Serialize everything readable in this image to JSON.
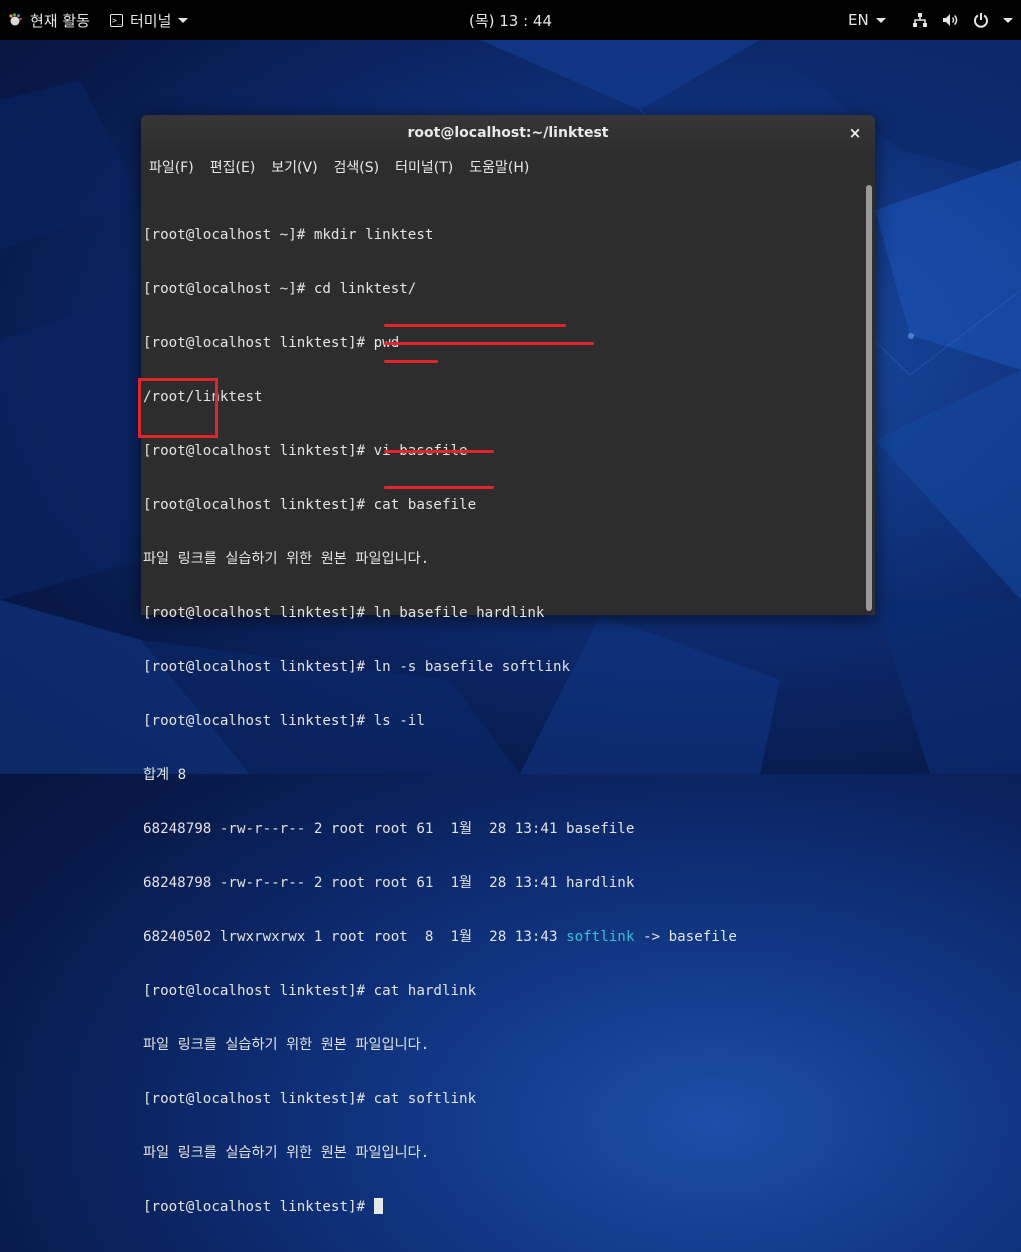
{
  "topbar": {
    "activities": "현재 활동",
    "app_menu": "터미널",
    "clock": "(목) 13 : 44",
    "language": "EN",
    "icons": [
      "network-icon",
      "volume-icon",
      "power-icon"
    ]
  },
  "window": {
    "title": "root@localhost:~/linktest",
    "close": "×",
    "menu": [
      "파일(F)",
      "편집(E)",
      "보기(V)",
      "검색(S)",
      "터미널(T)",
      "도움말(H)"
    ]
  },
  "terminal": {
    "lines": [
      "[root@localhost ~]# mkdir linktest",
      "[root@localhost ~]# cd linktest/",
      "[root@localhost linktest]# pwd",
      "/root/linktest",
      "[root@localhost linktest]# vi basefile",
      "[root@localhost linktest]# cat basefile",
      "파일 링크를 실습하기 위한 원본 파일입니다.",
      "[root@localhost linktest]# ln basefile hardlink",
      "[root@localhost linktest]# ln -s basefile softlink",
      "[root@localhost linktest]# ls -il",
      "합계 8",
      "68248798 -rw-r--r-- 2 root root 61  1월  28 13:41 basefile",
      "68248798 -rw-r--r-- 2 root root 61  1월  28 13:41 hardlink",
      "68240502 lrwxrwxrwx 1 root root  8  1월  28 13:43 ",
      "[root@localhost linktest]# cat hardlink",
      "파일 링크를 실습하기 위한 원본 파일입니다.",
      "[root@localhost linktest]# cat softlink",
      "파일 링크를 실습하기 위한 원본 파일입니다.",
      "[root@localhost linktest]# "
    ],
    "softlink_name": "softlink",
    "softlink_target": " -> basefile"
  },
  "colors": {
    "annotation": "#e0262b",
    "link_cyan": "#33c3d6",
    "terminal_bg": "#2d2d2d"
  }
}
